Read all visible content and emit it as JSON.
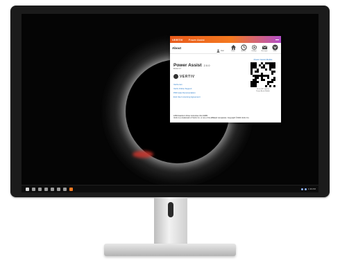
{
  "app": {
    "brand": "VERTIV",
    "window_title": "Power Assist",
    "page_title": "About",
    "name": "Power Assist",
    "version": "2.0.0",
    "build": "BUILD 47",
    "logo_text": "VERTIV",
    "links": [
      {
        "label": "Vertiv.com"
      },
      {
        "label": "Vertiv Online Support"
      },
      {
        "label": "PDF Help Documentation"
      },
      {
        "label": "End User Licensing Agreement"
      }
    ],
    "footer_line1": "1050 Dearborn Drive Columbus OH 43085",
    "footer_line2": "Vertiv is a trademark of Vertiv Co. or one of its affiliated companies. Copyright ©2024 Vertiv Co.",
    "qr_title": "Power Assist Mobile",
    "qr_caption1": "Scan QR Code for",
    "qr_caption2": "Power Assist Mobile",
    "user_label": "User",
    "toolbar_buttons": [
      {
        "label": "Home",
        "icon": "home-icon"
      },
      {
        "label": "Actions",
        "icon": "clock-icon"
      },
      {
        "label": "Settings",
        "icon": "gear-icon"
      },
      {
        "label": "Messages",
        "icon": "mail-icon"
      },
      {
        "label": "Vertiv",
        "icon": "vertiv-logo-icon"
      }
    ],
    "colors": {
      "accent": "#f47920",
      "link": "#1a73c8"
    }
  },
  "taskbar": {
    "time": "1:36 PM"
  }
}
